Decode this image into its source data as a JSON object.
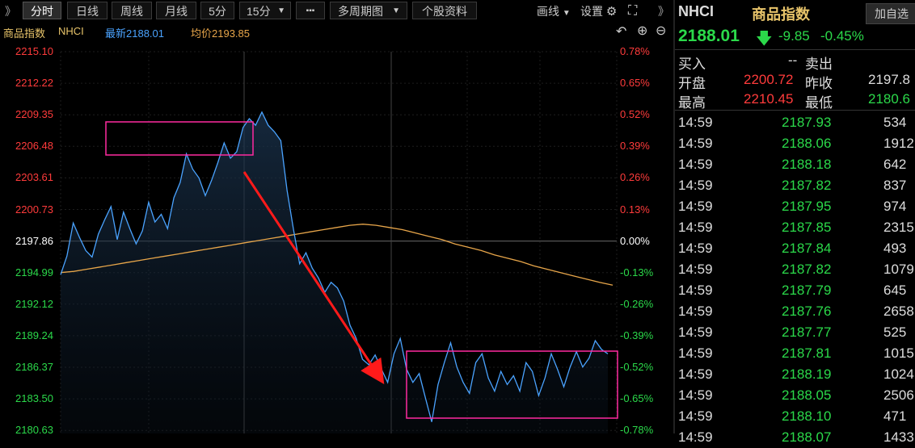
{
  "toolbar": {
    "expand_left": "》",
    "tabs": [
      "分时",
      "日线",
      "周线",
      "月线",
      "5分"
    ],
    "period_select": "15分",
    "more": "▪▪▪",
    "multi_period": "多周期图",
    "stock_info": "个股资料",
    "draw_line": "画线",
    "settings": "设置",
    "collapse_right": "》"
  },
  "infobar": {
    "name": "商品指数",
    "code": "NHCI",
    "latest": "最新2188.01",
    "avg": "均价2193.85"
  },
  "axis": {
    "left": [
      "2215.10",
      "2212.22",
      "2209.35",
      "2206.48",
      "2203.61",
      "2200.73",
      "2197.86",
      "2194.99",
      "2192.12",
      "2189.24",
      "2186.37",
      "2183.50",
      "2180.63"
    ],
    "right": [
      "0.78%",
      "0.65%",
      "0.52%",
      "0.39%",
      "0.26%",
      "0.13%",
      "0.00%",
      "-0.13%",
      "-0.26%",
      "-0.39%",
      "-0.52%",
      "-0.65%",
      "-0.78%"
    ]
  },
  "chart_data": {
    "type": "line",
    "ylim": [
      2180.63,
      2215.1
    ],
    "base": 2197.86,
    "series": [
      {
        "values": [
          2194.8,
          2196.5,
          2199.5,
          2198.2,
          2197.0,
          2196.4,
          2198.5,
          2199.8,
          2201.0,
          2198.0,
          2200.5,
          2199.0,
          2197.6,
          2198.8,
          2201.4,
          2199.6,
          2200.3,
          2199.0,
          2201.8,
          2203.2,
          2205.8,
          2204.4,
          2203.6,
          2202.0,
          2203.4,
          2205.0,
          2206.8,
          2205.4,
          2206.0,
          2208.2,
          2209.0,
          2208.4,
          2209.6,
          2208.4,
          2207.8,
          2207.0,
          2202.5,
          2199.0,
          2195.8,
          2196.8,
          2195.4,
          2194.5,
          2193.2,
          2194.1,
          2193.6,
          2192.4,
          2190.2,
          2189.0,
          2187.1,
          2186.6,
          2187.5,
          2186.2,
          2185.0,
          2187.6,
          2189.0,
          2186.2,
          2185.0,
          2185.8,
          2183.6,
          2181.4,
          2184.8,
          2186.8,
          2188.6,
          2186.4,
          2185.0,
          2184.0,
          2186.8,
          2187.6,
          2185.4,
          2184.2,
          2186.0,
          2184.8,
          2185.6,
          2184.2,
          2186.8,
          2186.0,
          2183.8,
          2185.4,
          2187.6,
          2186.2,
          2184.6,
          2186.4,
          2187.8,
          2186.4,
          2187.2,
          2188.8,
          2188.0,
          2187.6
        ],
        "color": "#4aa3ff"
      },
      {
        "values": [
          2194.99,
          2195.1,
          2195.3,
          2195.5,
          2195.7,
          2195.9,
          2196.1,
          2196.3,
          2196.5,
          2196.7,
          2196.9,
          2197.1,
          2197.3,
          2197.5,
          2197.7,
          2197.9,
          2198.1,
          2198.3,
          2198.5,
          2198.7,
          2198.9,
          2199.1,
          2199.3,
          2199.4,
          2199.3,
          2199.1,
          2198.9,
          2198.6,
          2198.3,
          2198.0,
          2197.6,
          2197.3,
          2197.0,
          2196.6,
          2196.3,
          2196.0,
          2195.6,
          2195.3,
          2195.0,
          2194.7,
          2194.4,
          2194.1,
          2193.85
        ],
        "color": "#e8a64a"
      }
    ]
  },
  "panel": {
    "code": "NHCI",
    "name": "商品指数",
    "add_btn": "加自选",
    "price": "2188.01",
    "change": "-9.85",
    "change_pct": "-0.45%",
    "buy_label": "买入",
    "buy_val": "--",
    "sell_label": "卖出",
    "open_label": "开盘",
    "open_val": "2200.72",
    "prev_label": "昨收",
    "prev_val": "2197.8",
    "high_label": "最高",
    "high_val": "2210.45",
    "low_label": "最低",
    "low_val": "2180.6"
  },
  "ticks": [
    {
      "time": "14:59",
      "price": "2187.93",
      "vol": "534"
    },
    {
      "time": "14:59",
      "price": "2188.06",
      "vol": "1912"
    },
    {
      "time": "14:59",
      "price": "2188.18",
      "vol": "642"
    },
    {
      "time": "14:59",
      "price": "2187.82",
      "vol": "837"
    },
    {
      "time": "14:59",
      "price": "2187.95",
      "vol": "974"
    },
    {
      "time": "14:59",
      "price": "2187.85",
      "vol": "2315"
    },
    {
      "time": "14:59",
      "price": "2187.84",
      "vol": "493"
    },
    {
      "time": "14:59",
      "price": "2187.82",
      "vol": "1079"
    },
    {
      "time": "14:59",
      "price": "2187.79",
      "vol": "645"
    },
    {
      "time": "14:59",
      "price": "2187.76",
      "vol": "2658"
    },
    {
      "time": "14:59",
      "price": "2187.77",
      "vol": "525"
    },
    {
      "time": "14:59",
      "price": "2187.81",
      "vol": "1015"
    },
    {
      "time": "14:59",
      "price": "2188.19",
      "vol": "1024"
    },
    {
      "time": "14:59",
      "price": "2188.05",
      "vol": "2506"
    },
    {
      "time": "14:59",
      "price": "2188.10",
      "vol": "471"
    },
    {
      "time": "14:59",
      "price": "2188.07",
      "vol": "1433"
    }
  ]
}
